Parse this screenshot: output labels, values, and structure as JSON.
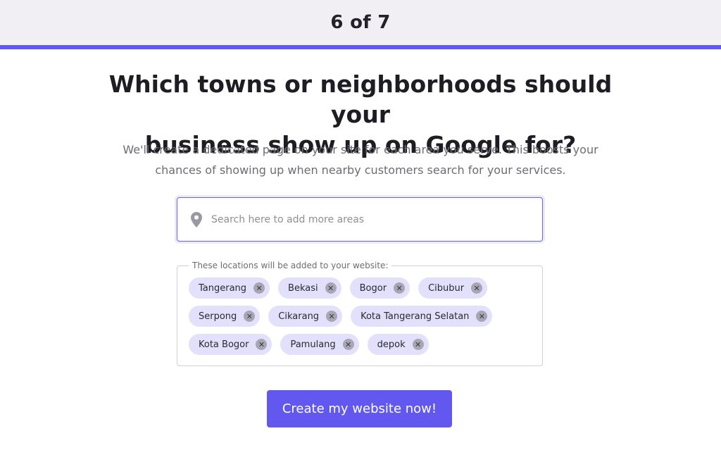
{
  "header": {
    "step_label": "6 of 7"
  },
  "progress": {
    "current_step": 6,
    "total_steps": 7,
    "fill_fraction": 1.0,
    "color": "#6257ee"
  },
  "main": {
    "headline_line1": "Which towns or neighborhoods should your",
    "headline_line2": "business show up on Google for?",
    "subtext_line1": "We'll create a dedicated page on your site for each area you serve. This boosts your",
    "subtext_line2": "chances of showing up when nearby customers search for your services."
  },
  "search": {
    "placeholder": "Search here to add more areas",
    "value": "",
    "icon": "map-pin-icon"
  },
  "locations": {
    "legend": "These locations will be added to your website:",
    "remove_icon": "close-icon",
    "rows": [
      [
        "Tangerang",
        "Bekasi",
        "Bogor",
        "Cibubur"
      ],
      [
        "Serpong",
        "Cikarang",
        "Kota Tangerang Selatan"
      ],
      [
        "Kota Bogor",
        "Pamulang",
        "depok"
      ]
    ]
  },
  "cta": {
    "label": "Create my website now!"
  },
  "colors": {
    "accent": "#6257ee",
    "chip_bg": "#e3e0fb",
    "top_bar_bg": "#f1eff4"
  }
}
